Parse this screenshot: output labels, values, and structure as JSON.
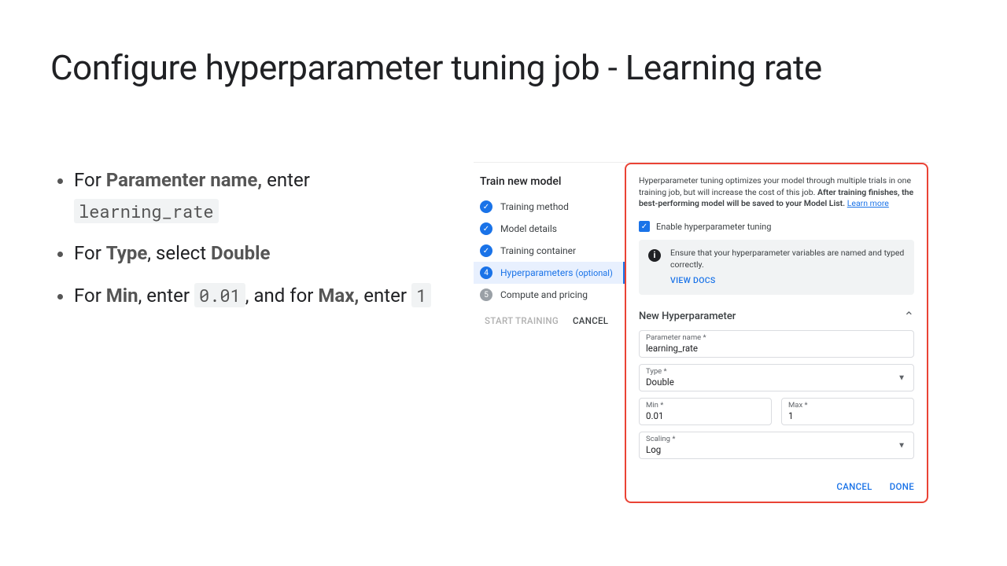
{
  "title": "Configure hyperparameter tuning job - Learning rate",
  "bullets": {
    "b1": {
      "pre": "For ",
      "label": "Paramenter name,",
      "mid": " enter ",
      "code": "learning_rate"
    },
    "b2": {
      "pre": "For ",
      "label": "Type",
      "mid": ", select ",
      "post": "Double"
    },
    "b3": {
      "pre": "For ",
      "min": "Min",
      "t1": ", enter ",
      "c1": "0.01",
      "t2": ", and for ",
      "max": "Max,",
      "t3": " enter ",
      "c2": "1"
    }
  },
  "leftPane": {
    "heading": "Train new model",
    "steps": [
      {
        "label": "Training method"
      },
      {
        "label": "Model details"
      },
      {
        "label": "Training container"
      },
      {
        "label": "Hyperparameters",
        "optional": "(optional)"
      },
      {
        "label": "Compute and pricing"
      }
    ],
    "start": "START TRAINING",
    "cancel": "CANCEL"
  },
  "rightPane": {
    "intro1": "Hyperparameter tuning optimizes your model through multiple trials in one training job, but will increase the cost of this job. ",
    "intro2": "After training finishes, the best-performing model will be saved to your Model List.",
    "learn": "Learn more",
    "checkbox": "Enable hyperparameter tuning",
    "infoMsg": "Ensure that your hyperparameter variables are named and typed correctly.",
    "viewDocs": "VIEW DOCS",
    "sectionTitle": "New Hyperparameter",
    "fields": {
      "paramName": {
        "label": "Parameter name *",
        "value": "learning_rate"
      },
      "type": {
        "label": "Type *",
        "value": "Double"
      },
      "min": {
        "label": "Min *",
        "value": "0.01"
      },
      "max": {
        "label": "Max *",
        "value": "1"
      },
      "scaling": {
        "label": "Scaling *",
        "value": "Log"
      }
    },
    "cancel": "CANCEL",
    "done": "DONE"
  }
}
